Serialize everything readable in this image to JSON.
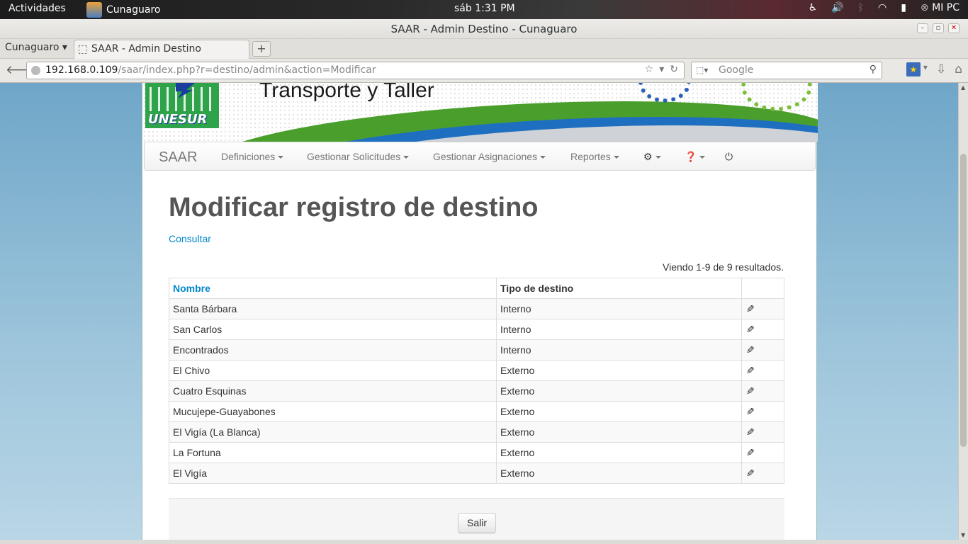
{
  "topbar": {
    "activities": "Actividades",
    "app_name": "Cunaguaro",
    "clock": "sáb  1:31 PM",
    "user": "MI PC"
  },
  "window": {
    "title": "SAAR - Admin Destino - Cunaguaro"
  },
  "tabs": {
    "app_menu": "Cunaguaro",
    "active_tab": "SAAR - Admin Destino",
    "new_tab": "+"
  },
  "nav": {
    "url_host": "192.168.0.109",
    "url_path": "/saar/index.php?r=destino/admin&action=Modificar",
    "search_placeholder": "Google"
  },
  "banner": {
    "title": "Transporte y Taller",
    "logo_text": "UNESUR"
  },
  "appnav": {
    "brand": "SAAR",
    "items": [
      "Definiciones",
      "Gestionar Solicitudes",
      "Gestionar Asignaciones",
      "Reportes"
    ]
  },
  "main": {
    "heading": "Modificar registro de destino",
    "consultar": "Consultar",
    "summary": "Viendo 1-9 de 9 resultados.",
    "columns": [
      "Nombre",
      "Tipo de destino",
      ""
    ],
    "rows": [
      [
        "Santa Bárbara",
        "Interno"
      ],
      [
        "San Carlos",
        "Interno"
      ],
      [
        "Encontrados",
        "Interno"
      ],
      [
        "El Chivo",
        "Externo"
      ],
      [
        "Cuatro Esquinas",
        "Externo"
      ],
      [
        "Mucujepe-Guayabones",
        "Externo"
      ],
      [
        "El Vigía (La Blanca)",
        "Externo"
      ],
      [
        "La Fortuna",
        "Externo"
      ],
      [
        "El Vigía",
        "Externo"
      ]
    ],
    "exit_button": "Salir"
  }
}
